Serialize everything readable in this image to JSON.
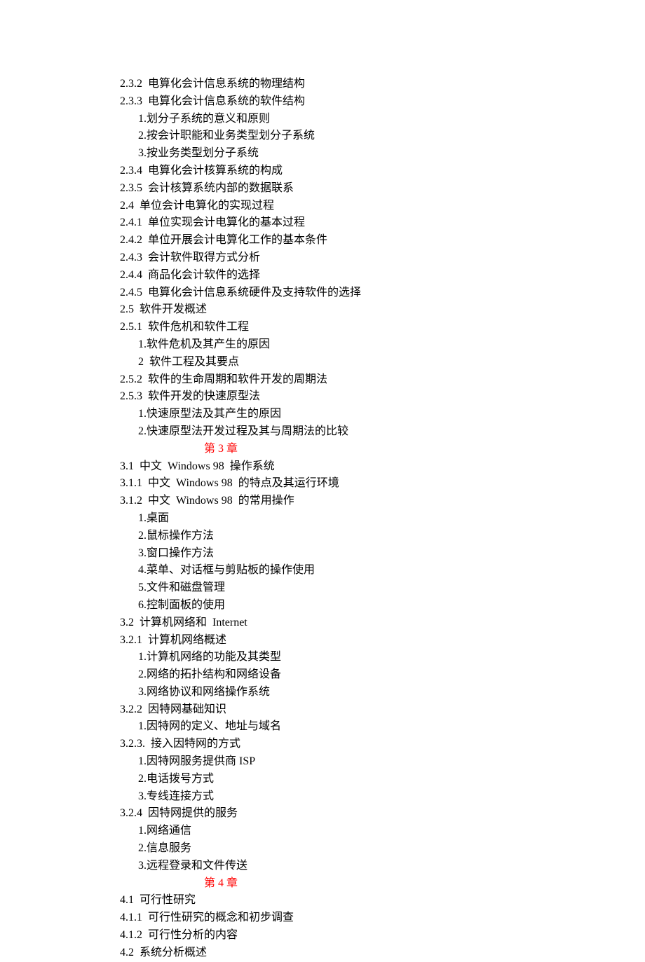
{
  "lines": [
    {
      "cls": "lvl-2",
      "text": "2.3.2  电算化会计信息系统的物理结构"
    },
    {
      "cls": "lvl-2",
      "text": "2.3.3  电算化会计信息系统的软件结构"
    },
    {
      "cls": "lvl-3",
      "text": "1.划分子系统的意义和原则"
    },
    {
      "cls": "lvl-3",
      "text": "2.按会计职能和业务类型划分子系统"
    },
    {
      "cls": "lvl-3",
      "text": "3.按业务类型划分子系统"
    },
    {
      "cls": "lvl-2",
      "text": "2.3.4  电算化会计核算系统的构成"
    },
    {
      "cls": "lvl-2",
      "text": "2.3.5  会计核算系统内部的数据联系"
    },
    {
      "cls": "lvl-1",
      "text": "2.4  单位会计电算化的实现过程"
    },
    {
      "cls": "lvl-2",
      "text": "2.4.1  单位实现会计电算化的基本过程"
    },
    {
      "cls": "lvl-2",
      "text": "2.4.2  单位开展会计电算化工作的基本条件"
    },
    {
      "cls": "lvl-2",
      "text": "2.4.3  会计软件取得方式分析"
    },
    {
      "cls": "lvl-2",
      "text": "2.4.4  商品化会计软件的选择"
    },
    {
      "cls": "lvl-2",
      "text": "2.4.5  电算化会计信息系统硬件及支持软件的选择"
    },
    {
      "cls": "lvl-1",
      "text": "2.5  软件开发概述"
    },
    {
      "cls": "lvl-2",
      "text": "2.5.1  软件危机和软件工程"
    },
    {
      "cls": "lvl-3",
      "text": "1.软件危机及其产生的原因"
    },
    {
      "cls": "lvl-3",
      "text": "2  软件工程及其要点"
    },
    {
      "cls": "lvl-2",
      "text": "2.5.2  软件的生命周期和软件开发的周期法"
    },
    {
      "cls": "lvl-2",
      "text": "2.5.3  软件开发的快速原型法"
    },
    {
      "cls": "lvl-3",
      "text": "1.快速原型法及其产生的原因"
    },
    {
      "cls": "lvl-3",
      "text": "2.快速原型法开发过程及其与周期法的比较"
    },
    {
      "cls": "chapter",
      "text": "第 3 章"
    },
    {
      "cls": "lvl-1",
      "text": "3.1  中文  Windows 98  操作系统"
    },
    {
      "cls": "lvl-2",
      "text": "3.1.1  中文  Windows 98  的特点及其运行环境"
    },
    {
      "cls": "lvl-2",
      "text": "3.1.2  中文  Windows 98  的常用操作"
    },
    {
      "cls": "lvl-3",
      "text": "1.桌面"
    },
    {
      "cls": "lvl-3",
      "text": "2.鼠标操作方法"
    },
    {
      "cls": "lvl-3",
      "text": "3.窗口操作方法"
    },
    {
      "cls": "lvl-3",
      "text": "4.菜单、对话框与剪贴板的操作使用"
    },
    {
      "cls": "lvl-3",
      "text": "5.文件和磁盘管理"
    },
    {
      "cls": "lvl-3",
      "text": "6.控制面板的使用"
    },
    {
      "cls": "lvl-1",
      "text": "3.2  计算机网络和  Internet"
    },
    {
      "cls": "lvl-2",
      "text": "3.2.1  计算机网络概述"
    },
    {
      "cls": "lvl-3",
      "text": "1.计算机网络的功能及其类型"
    },
    {
      "cls": "lvl-3",
      "text": "2.网络的拓扑结构和网络设备"
    },
    {
      "cls": "lvl-3",
      "text": "3.网络协议和网络操作系统"
    },
    {
      "cls": "lvl-2",
      "text": "3.2.2  因特网基础知识"
    },
    {
      "cls": "lvl-3",
      "text": "1.因特网的定义、地址与域名"
    },
    {
      "cls": "lvl-2",
      "text": "3.2.3.  接入因特网的方式"
    },
    {
      "cls": "lvl-3",
      "text": "1.因特网服务提供商 ISP"
    },
    {
      "cls": "lvl-3",
      "text": "2.电话拨号方式"
    },
    {
      "cls": "lvl-3",
      "text": "3.专线连接方式"
    },
    {
      "cls": "lvl-2",
      "text": "3.2.4  因特网提供的服务"
    },
    {
      "cls": "lvl-3",
      "text": "1.网络通信"
    },
    {
      "cls": "lvl-3",
      "text": "2.信息服务"
    },
    {
      "cls": "lvl-3",
      "text": "3.远程登录和文件传送"
    },
    {
      "cls": "chapter",
      "text": "第 4 章"
    },
    {
      "cls": "lvl-1",
      "text": "4.1  可行性研究"
    },
    {
      "cls": "lvl-2",
      "text": "4.1.1  可行性研究的概念和初步调查"
    },
    {
      "cls": "lvl-2",
      "text": "4.1.2  可行性分析的内容"
    },
    {
      "cls": "lvl-1",
      "text": "4.2  系统分析概述"
    }
  ]
}
